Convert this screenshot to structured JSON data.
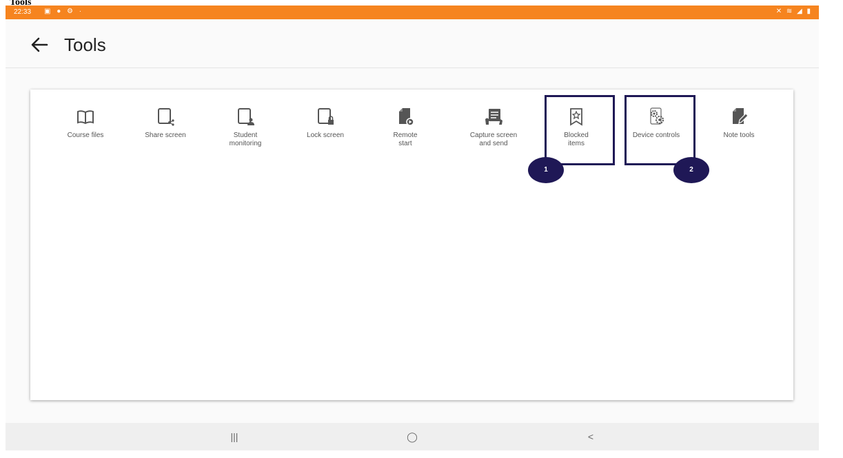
{
  "page_heading": "Tools",
  "status_bar": {
    "time": "22:33",
    "left_icons": "▣ ● ⚙ ·",
    "right_icons": "✕ ≋ ◢ ▮"
  },
  "app_bar": {
    "title": "Tools"
  },
  "tools": [
    {
      "label": "Course files",
      "icon": "book-icon"
    },
    {
      "label": "Share screen",
      "icon": "tablet-share-icon"
    },
    {
      "label": "Student\nmonitoring",
      "icon": "tablet-person-icon"
    },
    {
      "label": "Lock screen",
      "icon": "tablet-lock-icon"
    },
    {
      "label": "Remote\nstart",
      "icon": "file-play-icon"
    },
    {
      "label": "Capture screen\nand send",
      "icon": "capture-screen-icon"
    },
    {
      "label": "Blocked\nitems",
      "icon": "bookmark-star-icon"
    },
    {
      "label": "Device controls",
      "icon": "device-gears-icon"
    },
    {
      "label": "Note tools",
      "icon": "note-edit-icon"
    }
  ],
  "callouts": [
    "1",
    "2"
  ],
  "colors": {
    "status_bar": "#f6841f",
    "highlight": "#1f1856",
    "icon": "#555555"
  },
  "nav_bar": {
    "recents": "|||",
    "home": "◯",
    "back": "<"
  }
}
